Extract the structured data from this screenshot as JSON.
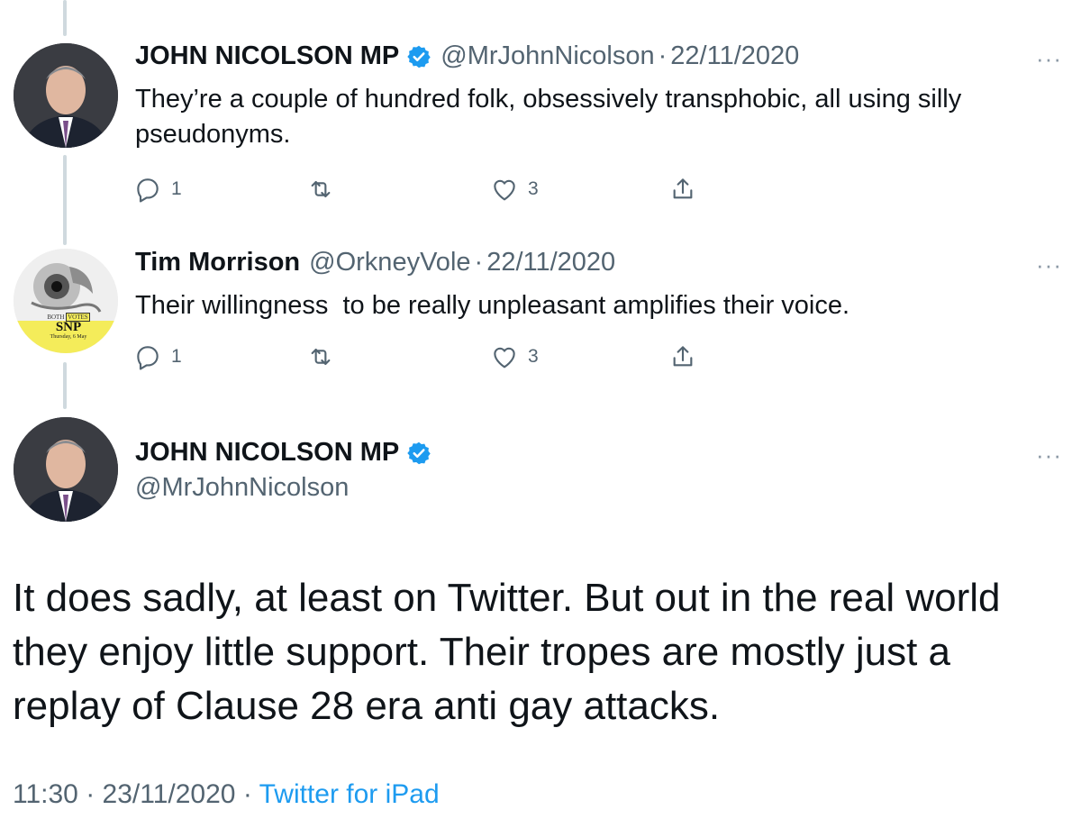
{
  "tweets": [
    {
      "name": "JOHN NICOLSON MP",
      "handle": "@MrJohnNicolson",
      "separator": "·",
      "date": "22/11/2020",
      "text": "They’re a couple of hundred folk, obsessively transphobic, all using silly\npseudonyms.",
      "reply_count": "1",
      "like_count": "3",
      "more": "···"
    },
    {
      "name": "Tim Morrison",
      "handle": "@OrkneyVole",
      "separator": "·",
      "date": "22/11/2020",
      "text": "Their willingness  to be really unpleasant amplifies their voice.",
      "reply_count": "1",
      "like_count": "3",
      "more": "···",
      "avatar_badge": {
        "line1": "BOTH",
        "line1b": "VOTES",
        "brand": "SNP",
        "date": "Thursday, 6 May"
      }
    }
  ],
  "main": {
    "name": "JOHN NICOLSON MP",
    "handle": "@MrJohnNicolson",
    "more": "···",
    "text": "It does sadly, at least on Twitter. But out in the real world they enjoy little support. Their tropes are mostly just a replay of Clause 28 era anti gay attacks.",
    "time": "11:30",
    "separator": "·",
    "date": "23/11/2020",
    "source": "Twitter for iPad"
  },
  "colors": {
    "verified": "#1d9bf0",
    "secondary_text": "#536471",
    "link": "#1d9bf0",
    "thread_line": "#cfd9de"
  }
}
